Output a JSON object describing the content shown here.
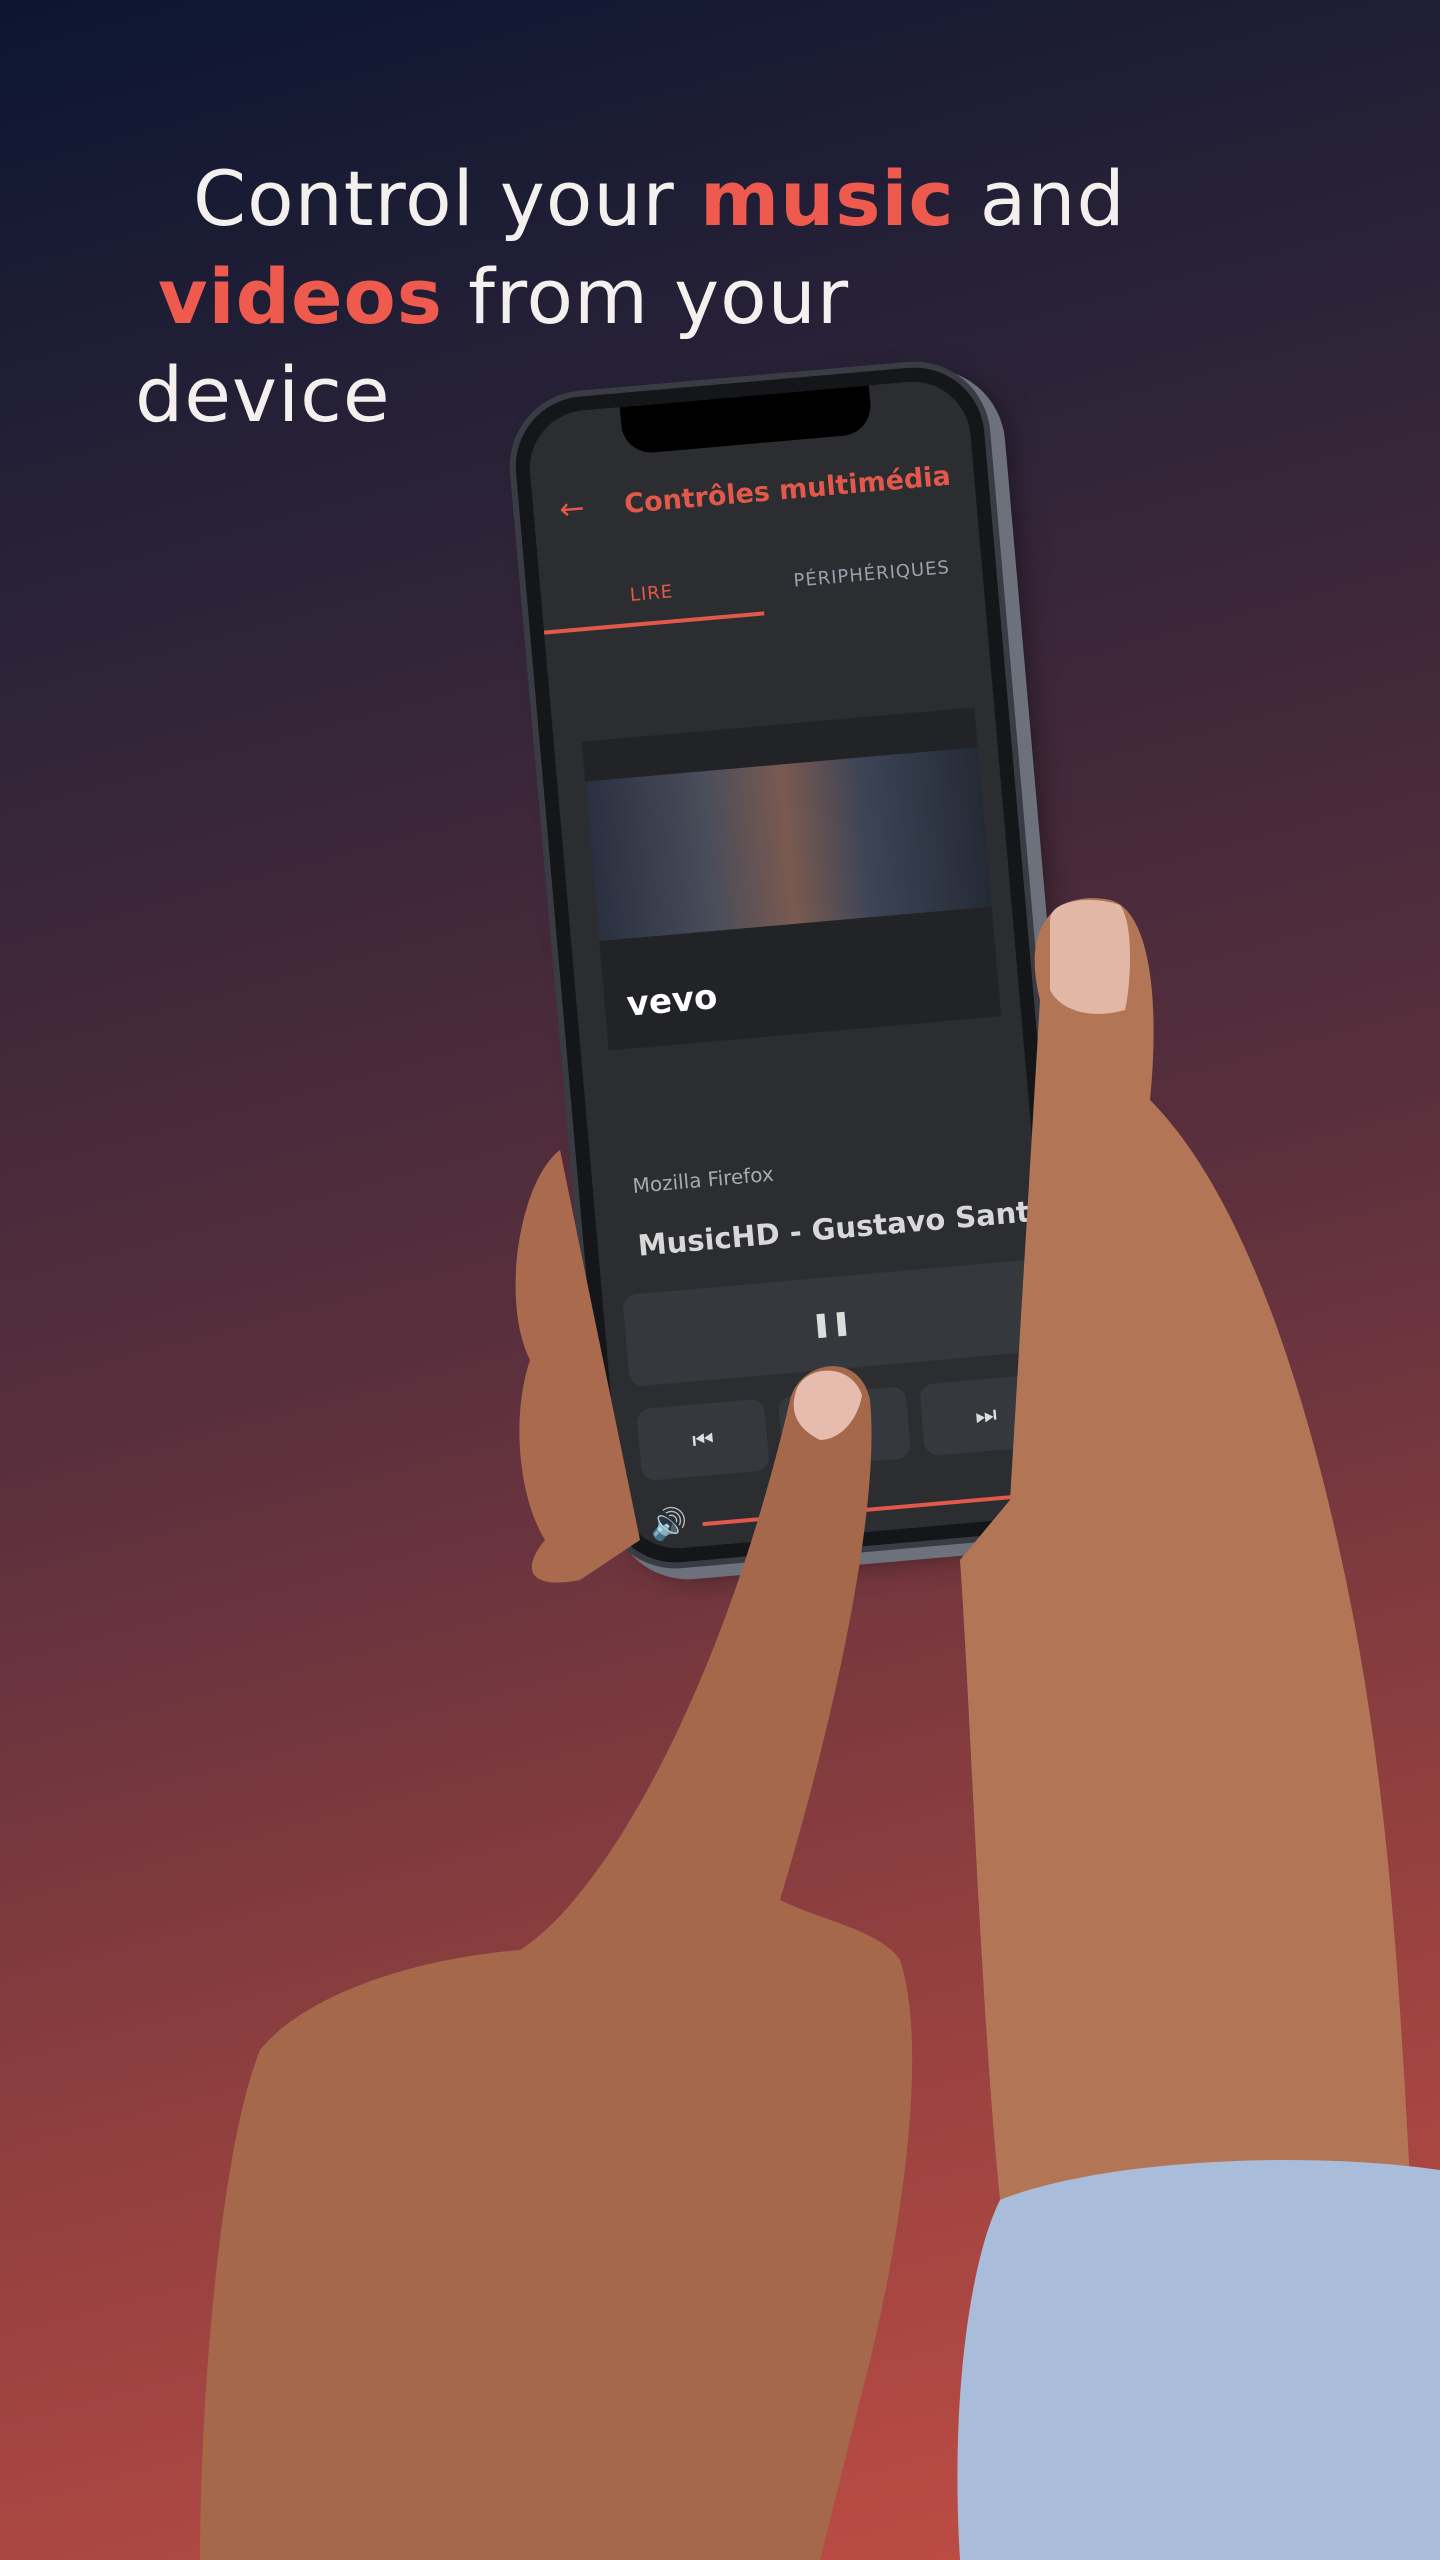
{
  "headline": {
    "line1_pre": "Control your ",
    "line1_accent": "music",
    "line1_post": " and",
    "line2_accent": "videos",
    "line2_post": " from your",
    "line3": "device"
  },
  "colors": {
    "accent": "#ee5b4e",
    "screen_bg": "#2b2d31",
    "sleeve": "#a9bcd9"
  },
  "app": {
    "title": "Contrôles multimédia",
    "back_icon": "arrow-left-icon",
    "tabs": [
      {
        "label": "LIRE",
        "active": true
      },
      {
        "label": "PÉRIPHÉRIQUES",
        "active": false
      }
    ],
    "video_brand": "vevo",
    "source": "Mozilla Firefox",
    "track_title": "MusicHD - Gustavo Santaolalla",
    "controls": {
      "pause_icon": "pause-icon",
      "prev_icon": "skip-previous-icon",
      "next_icon": "skip-next-icon",
      "pause": "❚❚",
      "prev": "⏮",
      "next": "⏭"
    },
    "volume_icon": "volume-icon",
    "volume": "🔊"
  }
}
